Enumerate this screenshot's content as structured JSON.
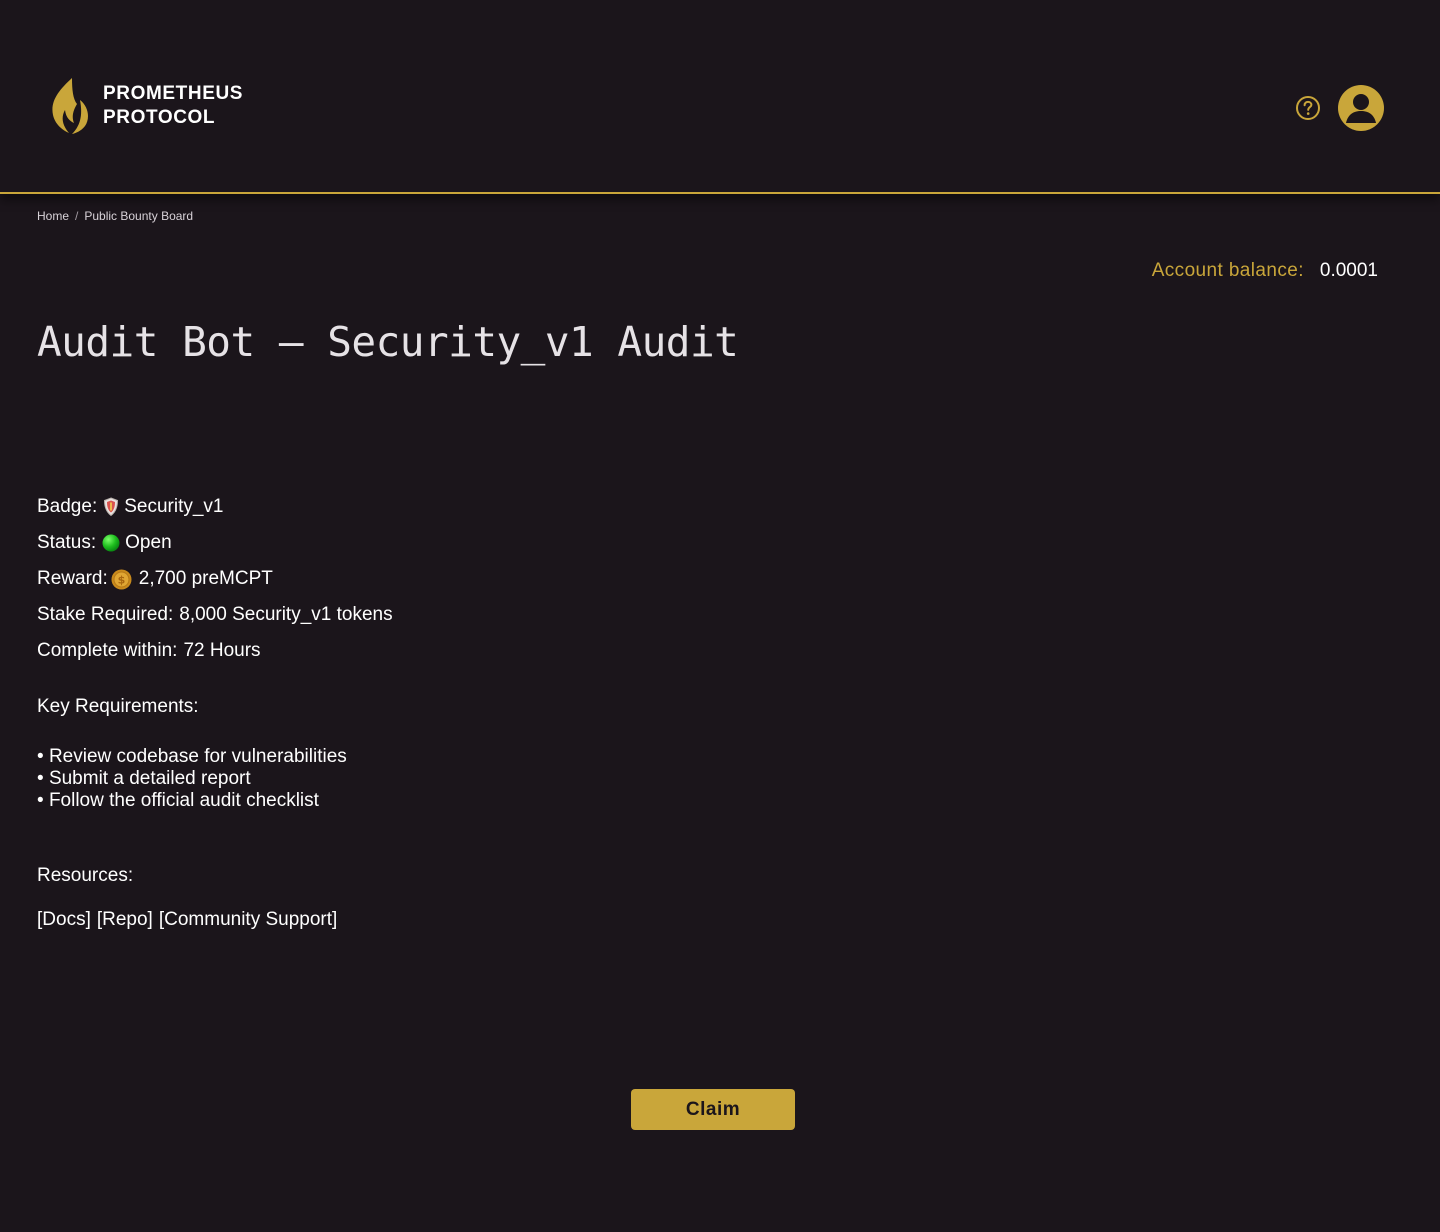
{
  "brand": {
    "line1": "PROMETHEUS",
    "line2": "PROTOCOL",
    "logo_icon": "flame-icon",
    "accent_color": "#c9a63a",
    "background_color": "#1b151b"
  },
  "header": {
    "help_icon": "question-circle-icon",
    "avatar_icon": "user-avatar-icon"
  },
  "breadcrumb": {
    "home": "Home",
    "separator": "/",
    "current": "Public Bounty Board"
  },
  "account": {
    "balance_label": "Account balance:",
    "balance_value": "0.0001"
  },
  "bounty": {
    "title": "Audit Bot — Security_v1 Audit",
    "badge_label": "Badge:",
    "badge_icon": "shield-emoji-icon",
    "badge_value": "Security_v1",
    "status_label": "Status:",
    "status_icon": "green-circle-icon",
    "status_value": "Open",
    "reward_label": "Reward:",
    "reward_icon": "coin-icon",
    "reward_value": "2,700 preMCPT",
    "stake_label": "Stake Required:",
    "stake_value": "8,000 Security_v1 tokens",
    "duration_label": "Complete within:",
    "duration_value": "72 Hours"
  },
  "requirements": {
    "heading": "Key Requirements:",
    "items": [
      "Review codebase for vulnerabilities",
      "Submit a detailed report",
      "Follow the official audit checklist"
    ]
  },
  "resources": {
    "heading": "Resources:",
    "links": [
      "[Docs]",
      "[Repo]",
      "[Community Support]"
    ]
  },
  "actions": {
    "claim_label": "Claim"
  }
}
